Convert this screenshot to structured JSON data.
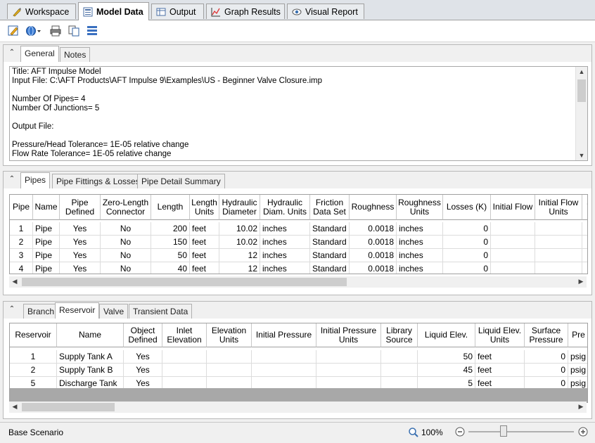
{
  "tabs": [
    {
      "label": "Workspace",
      "icon": "workspace-icon"
    },
    {
      "label": "Model Data",
      "icon": "model-data-icon",
      "active": true
    },
    {
      "label": "Output",
      "icon": "output-icon"
    },
    {
      "label": "Graph Results",
      "icon": "graph-icon"
    },
    {
      "label": "Visual Report",
      "icon": "visual-report-icon"
    }
  ],
  "general_panel": {
    "tabs": [
      "General",
      "Notes"
    ],
    "lines": [
      "Title: AFT Impulse Model",
      "Input File: C:\\AFT Products\\AFT Impulse 9\\Examples\\US - Beginner Valve Closure.imp",
      "",
      "Number Of Pipes= 4",
      "Number Of Junctions= 5",
      "",
      "Output File:",
      "",
      "Pressure/Head Tolerance= 1E-05 relative change",
      "Flow Rate Tolerance= 1E-05 relative change"
    ]
  },
  "pipes_panel": {
    "tabs": [
      "Pipes",
      "Pipe Fittings & Losses",
      "Pipe Detail Summary"
    ],
    "headers": [
      "Pipe",
      "Name",
      "Pipe\nDefined",
      "Zero-Length\nConnector",
      "Length",
      "Length\nUnits",
      "Hydraulic\nDiameter",
      "Hydraulic\nDiam. Units",
      "Friction\nData Set",
      "Roughness",
      "Roughness\nUnits",
      "Losses (K)",
      "Initial Flow",
      "Initial Flow\nUnits",
      "J\n("
    ],
    "rows": [
      [
        "1",
        "Pipe",
        "Yes",
        "No",
        "200",
        "feet",
        "10.02",
        "inches",
        "Standard",
        "0.0018",
        "inches",
        "0",
        "",
        "",
        ""
      ],
      [
        "2",
        "Pipe",
        "Yes",
        "No",
        "150",
        "feet",
        "10.02",
        "inches",
        "Standard",
        "0.0018",
        "inches",
        "0",
        "",
        "",
        ""
      ],
      [
        "3",
        "Pipe",
        "Yes",
        "No",
        "50",
        "feet",
        "12",
        "inches",
        "Standard",
        "0.0018",
        "inches",
        "0",
        "",
        "",
        ""
      ],
      [
        "4",
        "Pipe",
        "Yes",
        "No",
        "40",
        "feet",
        "12",
        "inches",
        "Standard",
        "0.0018",
        "inches",
        "0",
        "",
        "",
        ""
      ]
    ]
  },
  "junctions_panel": {
    "tabs": [
      "Branch",
      "Reservoir",
      "Valve",
      "Transient Data"
    ],
    "headers": [
      "Reservoir",
      "Name",
      "Object\nDefined",
      "Inlet\nElevation",
      "Elevation\nUnits",
      "Initial Pressure",
      "Initial Pressure\nUnits",
      "Library\nSource",
      "Liquid Elev.",
      "Liquid Elev.\nUnits",
      "Surface\nPressure",
      "Pre"
    ],
    "rows": [
      [
        "1",
        "Supply Tank A",
        "Yes",
        "",
        "",
        "",
        "",
        "",
        "50",
        "feet",
        "0",
        "psig"
      ],
      [
        "2",
        "Supply Tank B",
        "Yes",
        "",
        "",
        "",
        "",
        "",
        "45",
        "feet",
        "0",
        "psig"
      ],
      [
        "5",
        "Discharge Tank",
        "Yes",
        "",
        "",
        "",
        "",
        "",
        "5",
        "feet",
        "0",
        "psig"
      ]
    ]
  },
  "status": {
    "scenario": "Base Scenario",
    "zoom": "100%",
    "zoom_level": 0.33
  }
}
